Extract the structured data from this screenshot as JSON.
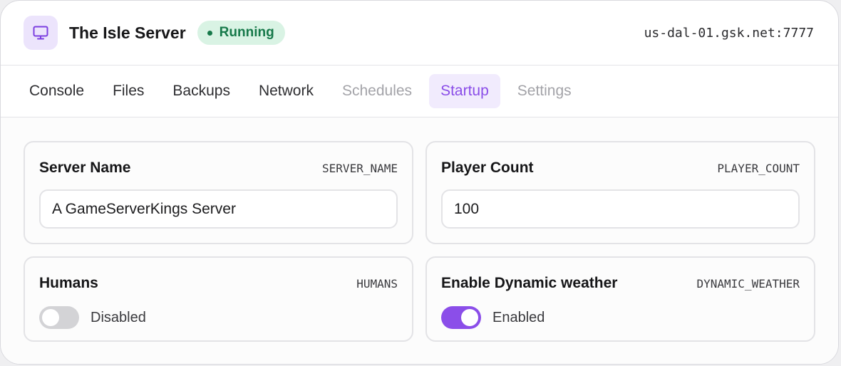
{
  "header": {
    "title": "The Isle Server",
    "status": "Running",
    "address": "us-dal-01.gsk.net:7777",
    "icon": "monitor-icon"
  },
  "colors": {
    "accent": "#8b4ee9",
    "status_bg": "#d9f3e4",
    "status_text": "#16794a"
  },
  "tabs": [
    {
      "label": "Console",
      "state": "normal"
    },
    {
      "label": "Files",
      "state": "normal"
    },
    {
      "label": "Backups",
      "state": "normal"
    },
    {
      "label": "Network",
      "state": "normal"
    },
    {
      "label": "Schedules",
      "state": "disabled"
    },
    {
      "label": "Startup",
      "state": "active"
    },
    {
      "label": "Settings",
      "state": "disabled"
    }
  ],
  "variables": {
    "server_name": {
      "label": "Server Name",
      "var": "SERVER_NAME",
      "value": "A GameServerKings Server"
    },
    "player_count": {
      "label": "Player Count",
      "var": "PLAYER_COUNT",
      "value": "100"
    },
    "humans": {
      "label": "Humans",
      "var": "HUMANS",
      "enabled": false,
      "state_text": "Disabled"
    },
    "dynamic_weather": {
      "label": "Enable Dynamic weather",
      "var": "DYNAMIC_WEATHER",
      "enabled": true,
      "state_text": "Enabled"
    }
  }
}
